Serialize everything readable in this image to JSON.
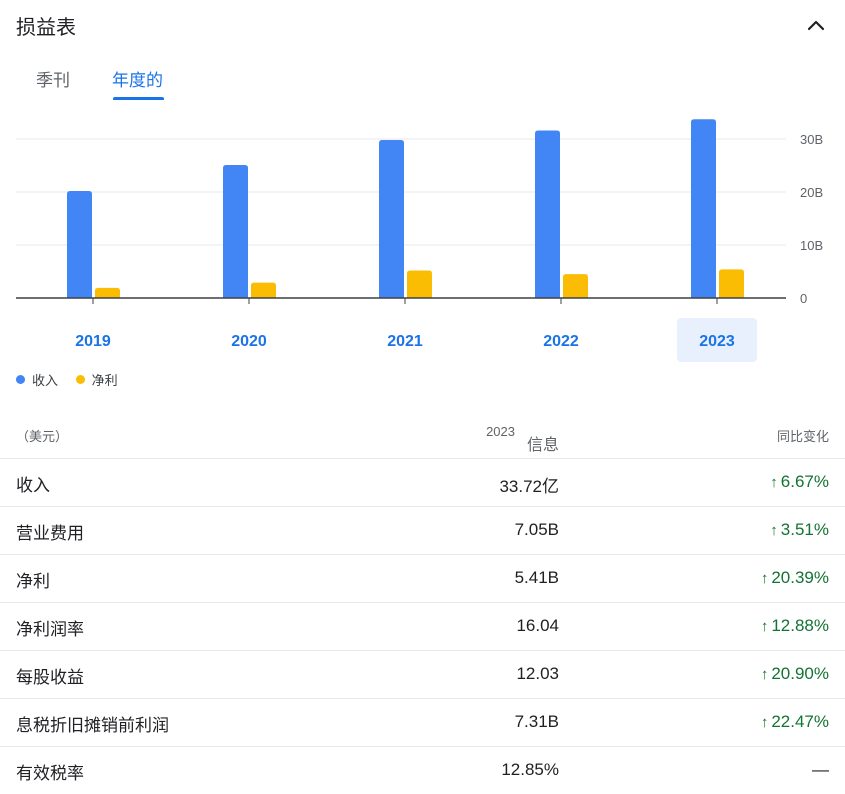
{
  "header": {
    "title": "损益表",
    "collapse_icon": "chevron-up-icon"
  },
  "tabs": [
    {
      "label": "季刊",
      "active": false
    },
    {
      "label": "年度的",
      "active": true
    }
  ],
  "colors": {
    "revenue": "#4285f4",
    "net_income": "#fbbc04",
    "accent": "#1a73e8",
    "positive": "#137333",
    "selected_bg": "#e8f0fe"
  },
  "chart_data": {
    "type": "bar",
    "categories": [
      "2019",
      "2020",
      "2021",
      "2022",
      "2023"
    ],
    "series": [
      {
        "name": "收入",
        "values": [
          20.2,
          25.1,
          29.8,
          31.6,
          33.72
        ]
      },
      {
        "name": "净利",
        "values": [
          1.9,
          2.9,
          5.2,
          4.5,
          5.41
        ]
      }
    ],
    "y_ticks": [
      "0",
      "10B",
      "20B",
      "30B"
    ],
    "ylim": [
      0,
      30
    ],
    "grid": true,
    "legend_position": "bottom-left",
    "selected_category": "2023"
  },
  "legend": [
    {
      "label": "收入",
      "color": "#4285f4"
    },
    {
      "label": "净利",
      "color": "#fbbc04"
    }
  ],
  "table": {
    "unit_label": "（美元）",
    "year_label": "2023",
    "info_label": "信息",
    "change_label": "同比变化",
    "rows": [
      {
        "label": "收入",
        "value": "33.72亿",
        "change": "6.67%",
        "direction": "up"
      },
      {
        "label": "营业费用",
        "value": "7.05B",
        "change": "3.51%",
        "direction": "up"
      },
      {
        "label": "净利",
        "value": "5.41B",
        "change": "20.39%",
        "direction": "up"
      },
      {
        "label": "净利润率",
        "value": "16.04",
        "change": "12.88%",
        "direction": "up"
      },
      {
        "label": "每股收益",
        "value": "12.03",
        "change": "20.90%",
        "direction": "up"
      },
      {
        "label": "息税折旧摊销前利润",
        "value": "7.31B",
        "change": "22.47%",
        "direction": "up"
      },
      {
        "label": "有效税率",
        "value": "12.85%",
        "change": "—",
        "direction": "none"
      }
    ]
  }
}
